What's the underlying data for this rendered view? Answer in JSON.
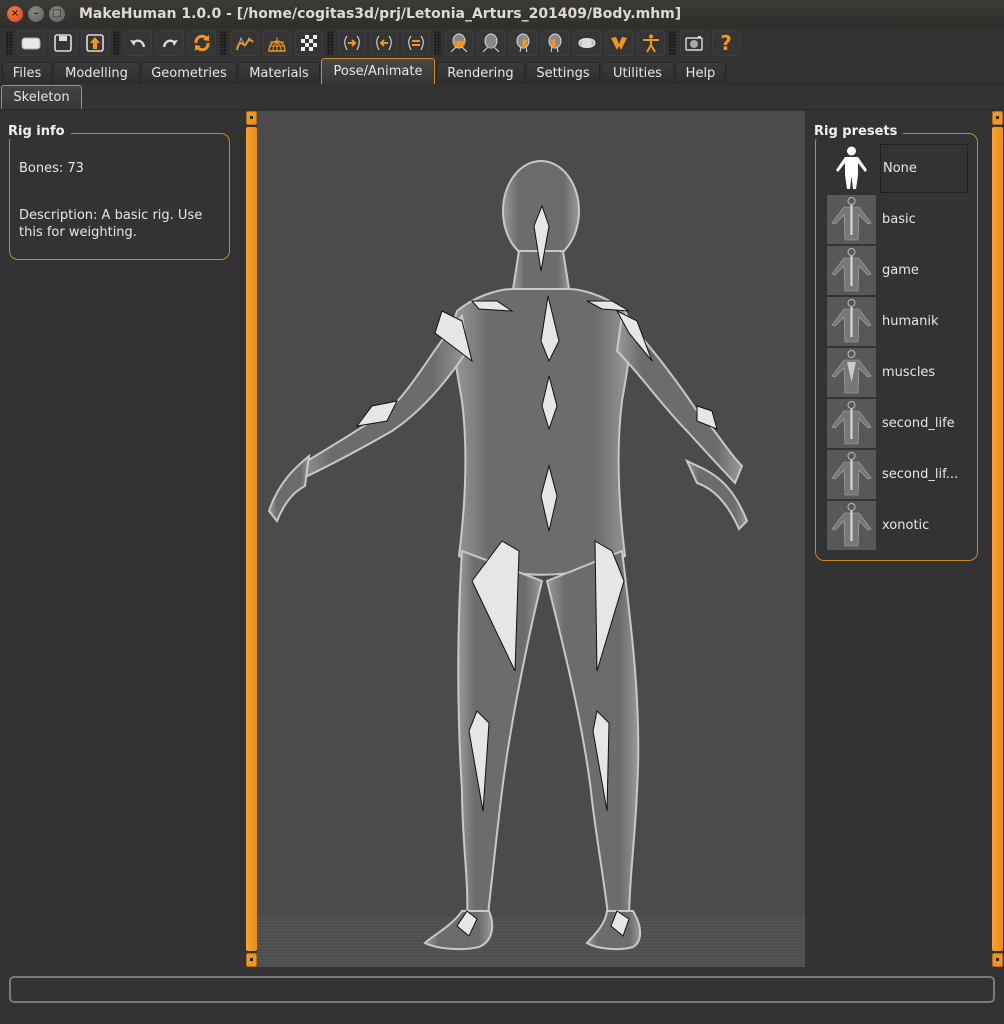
{
  "window": {
    "title": "MakeHuman 1.0.0 - [/home/cogitas3d/prj/Letonia_Arturs_201409/Body.mhm]"
  },
  "toolbar": {
    "buttons": [
      {
        "name": "load",
        "icon": "folder-icon"
      },
      {
        "name": "save",
        "icon": "save-icon"
      },
      {
        "name": "export",
        "icon": "export-icon"
      },
      {
        "name": "undo",
        "icon": "undo-icon"
      },
      {
        "name": "redo",
        "icon": "redo-icon"
      },
      {
        "name": "reset",
        "icon": "reset-icon"
      },
      {
        "name": "smooth",
        "icon": "smooth-icon"
      },
      {
        "name": "wireframe",
        "icon": "wireframe-icon"
      },
      {
        "name": "background",
        "icon": "checker-icon"
      },
      {
        "name": "pose",
        "icon": "pose-icon"
      },
      {
        "name": "front-view",
        "icon": "front-view-icon"
      },
      {
        "name": "back-view",
        "icon": "back-view-icon"
      },
      {
        "name": "left-view",
        "icon": "left-view-icon"
      },
      {
        "name": "right-view",
        "icon": "right-view-icon"
      },
      {
        "name": "top-view",
        "icon": "top-view-icon"
      },
      {
        "name": "bottom-view",
        "icon": "bottom-view-icon"
      },
      {
        "name": "global-camera",
        "icon": "global-camera-icon"
      },
      {
        "name": "symmetry",
        "icon": "symmetry-icon"
      },
      {
        "name": "screenshot",
        "icon": "camera-icon"
      },
      {
        "name": "help",
        "icon": "help-icon"
      }
    ],
    "accent_color": "#f0961e"
  },
  "tabs": [
    {
      "label": "Files"
    },
    {
      "label": "Modelling"
    },
    {
      "label": "Geometries"
    },
    {
      "label": "Materials"
    },
    {
      "label": "Pose/Animate",
      "active": true
    },
    {
      "label": "Rendering"
    },
    {
      "label": "Settings"
    },
    {
      "label": "Utilities"
    },
    {
      "label": "Help"
    }
  ],
  "subtabs": [
    {
      "label": "Skeleton",
      "active": true
    }
  ],
  "rig_info": {
    "title": "Rig info",
    "bones": "Bones: 73",
    "description_line1": "Description: A basic rig. Use",
    "description_line2": "this for weighting."
  },
  "rig_presets": {
    "title": "Rig presets",
    "items": [
      {
        "label": "None",
        "selected": true
      },
      {
        "label": "basic"
      },
      {
        "label": "game"
      },
      {
        "label": "humanik"
      },
      {
        "label": "muscles"
      },
      {
        "label": "second_life"
      },
      {
        "label": "second_lif..."
      },
      {
        "label": "xonotic"
      }
    ]
  },
  "colors": {
    "accent": "#f0961e",
    "group_border": "#c98a1e",
    "background": "#333333",
    "viewport": "#4b4b4b"
  },
  "statusbar": {
    "text": ""
  }
}
